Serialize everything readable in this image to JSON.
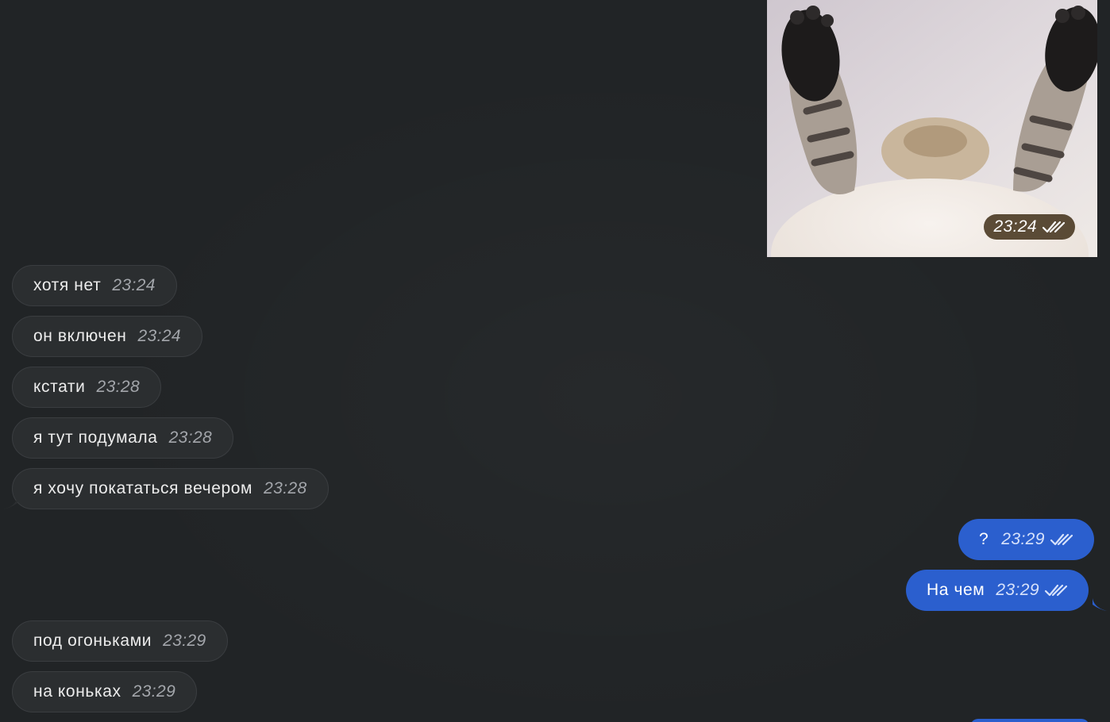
{
  "media_message": {
    "time": "23:24",
    "status_icon": "double-check-icon"
  },
  "messages": [
    {
      "side": "incoming",
      "text": "хотя нет",
      "time": "23:24"
    },
    {
      "side": "incoming",
      "text": "он включен",
      "time": "23:24"
    },
    {
      "side": "incoming",
      "text": "кстати",
      "time": "23:28"
    },
    {
      "side": "incoming",
      "text": "я тут подумала",
      "time": "23:28"
    },
    {
      "side": "incoming",
      "text": "я хочу покататься вечером",
      "time": "23:28"
    },
    {
      "side": "outgoing",
      "text": "?",
      "time": "23:29",
      "status_icon": "double-check-icon"
    },
    {
      "side": "outgoing",
      "text": "На чем",
      "time": "23:29",
      "status_icon": "double-check-icon"
    },
    {
      "side": "incoming",
      "text": "под огоньками",
      "time": "23:29"
    },
    {
      "side": "incoming",
      "text": "на коньках",
      "time": "23:29"
    }
  ],
  "colors": {
    "background": "#212426",
    "incoming_bubble": "#2b2e30",
    "outgoing_bubble": "#2b5fce"
  }
}
